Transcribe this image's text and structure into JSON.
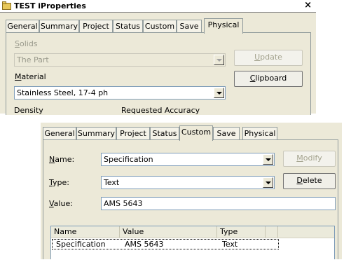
{
  "window1": {
    "title": "TEST iProperties",
    "close_glyph": "×",
    "tabs": [
      "General",
      "Summary",
      "Project",
      "Status",
      "Custom",
      "Save",
      "Physical"
    ],
    "active_tab": "Physical",
    "solids_label": "Solids",
    "solids_value": "The Part",
    "update_button": "Update",
    "material_label": "Material",
    "material_value": "Stainless Steel, 17-4 ph",
    "clipboard_button": "Clipboard",
    "density_label": "Density",
    "requested_accuracy_label": "Requested Accuracy"
  },
  "window2": {
    "tabs": [
      "General",
      "Summary",
      "Project",
      "Status",
      "Custom",
      "Save",
      "Physical"
    ],
    "active_tab": "Custom",
    "name_label": "Name:",
    "name_value": "Specification",
    "modify_button": "Modify",
    "type_label": "Type:",
    "type_value": "Text",
    "delete_button": "Delete",
    "value_label": "Value:",
    "value_value": "AMS 5643",
    "columns": [
      "Name",
      "Value",
      "Type"
    ],
    "rows": [
      {
        "name": "Specification",
        "value": "AMS 5643",
        "type": "Text"
      }
    ]
  }
}
